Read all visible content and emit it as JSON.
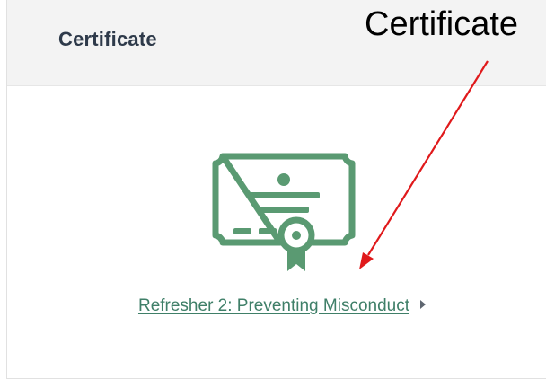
{
  "card": {
    "title": "Certificate",
    "link_text": "Refresher 2: Preventing Misconduct",
    "icon": "certificate-icon",
    "link_icon": "caret-right-icon"
  },
  "annotation": {
    "label": "Certificate",
    "color": "#e0191b"
  },
  "colors": {
    "accent": "#5a9a72",
    "link": "#3f7f68",
    "header_bg": "#f3f3f3",
    "title": "#2e3a4a"
  }
}
